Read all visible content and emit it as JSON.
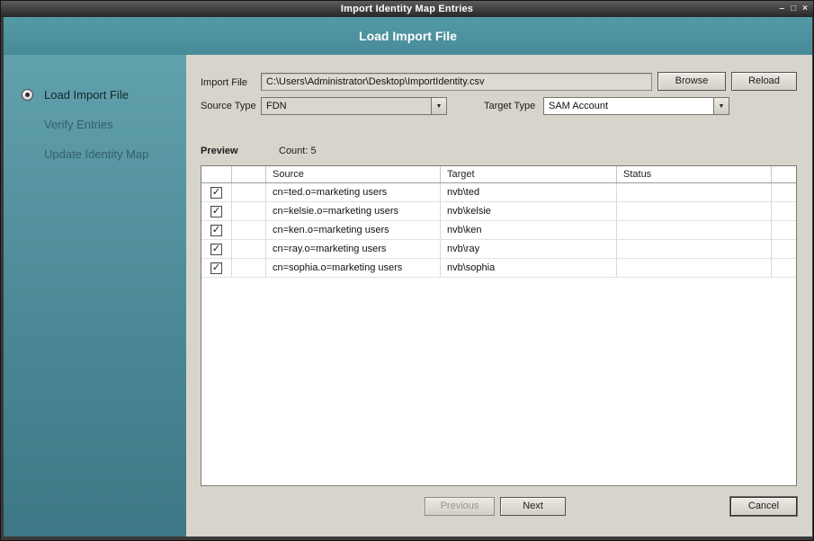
{
  "window": {
    "title": "Import Identity Map Entries",
    "controls": {
      "minimize": "–",
      "maximize": "□",
      "close": "×"
    }
  },
  "header": {
    "title": "Load Import File"
  },
  "sidebar": {
    "steps": [
      {
        "label": "Load Import File",
        "active": true
      },
      {
        "label": "Verify Entries",
        "active": false
      },
      {
        "label": "Update Identity Map",
        "active": false
      }
    ]
  },
  "form": {
    "import_file_label": "Import File",
    "import_file_value": "C:\\Users\\Administrator\\Desktop\\ImportIdentity.csv",
    "browse_label": "Browse",
    "reload_label": "Reload",
    "source_type_label": "Source Type",
    "source_type_value": "FDN",
    "target_type_label": "Target Type",
    "target_type_value": "SAM Account"
  },
  "preview": {
    "label": "Preview",
    "count_label": "Count: 5",
    "columns": [
      "",
      "",
      "Source",
      "Target",
      "Status",
      ""
    ],
    "rows": [
      {
        "checked": true,
        "source": "cn=ted.o=marketing users",
        "target": "nvb\\ted",
        "status": ""
      },
      {
        "checked": true,
        "source": "cn=kelsie.o=marketing users",
        "target": "nvb\\kelsie",
        "status": ""
      },
      {
        "checked": true,
        "source": "cn=ken.o=marketing users",
        "target": "nvb\\ken",
        "status": ""
      },
      {
        "checked": true,
        "source": "cn=ray.o=marketing users",
        "target": "nvb\\ray",
        "status": ""
      },
      {
        "checked": true,
        "source": "cn=sophia.o=marketing users",
        "target": "nvb\\sophia",
        "status": ""
      }
    ]
  },
  "footer": {
    "previous_label": "Previous",
    "next_label": "Next",
    "cancel_label": "Cancel"
  }
}
